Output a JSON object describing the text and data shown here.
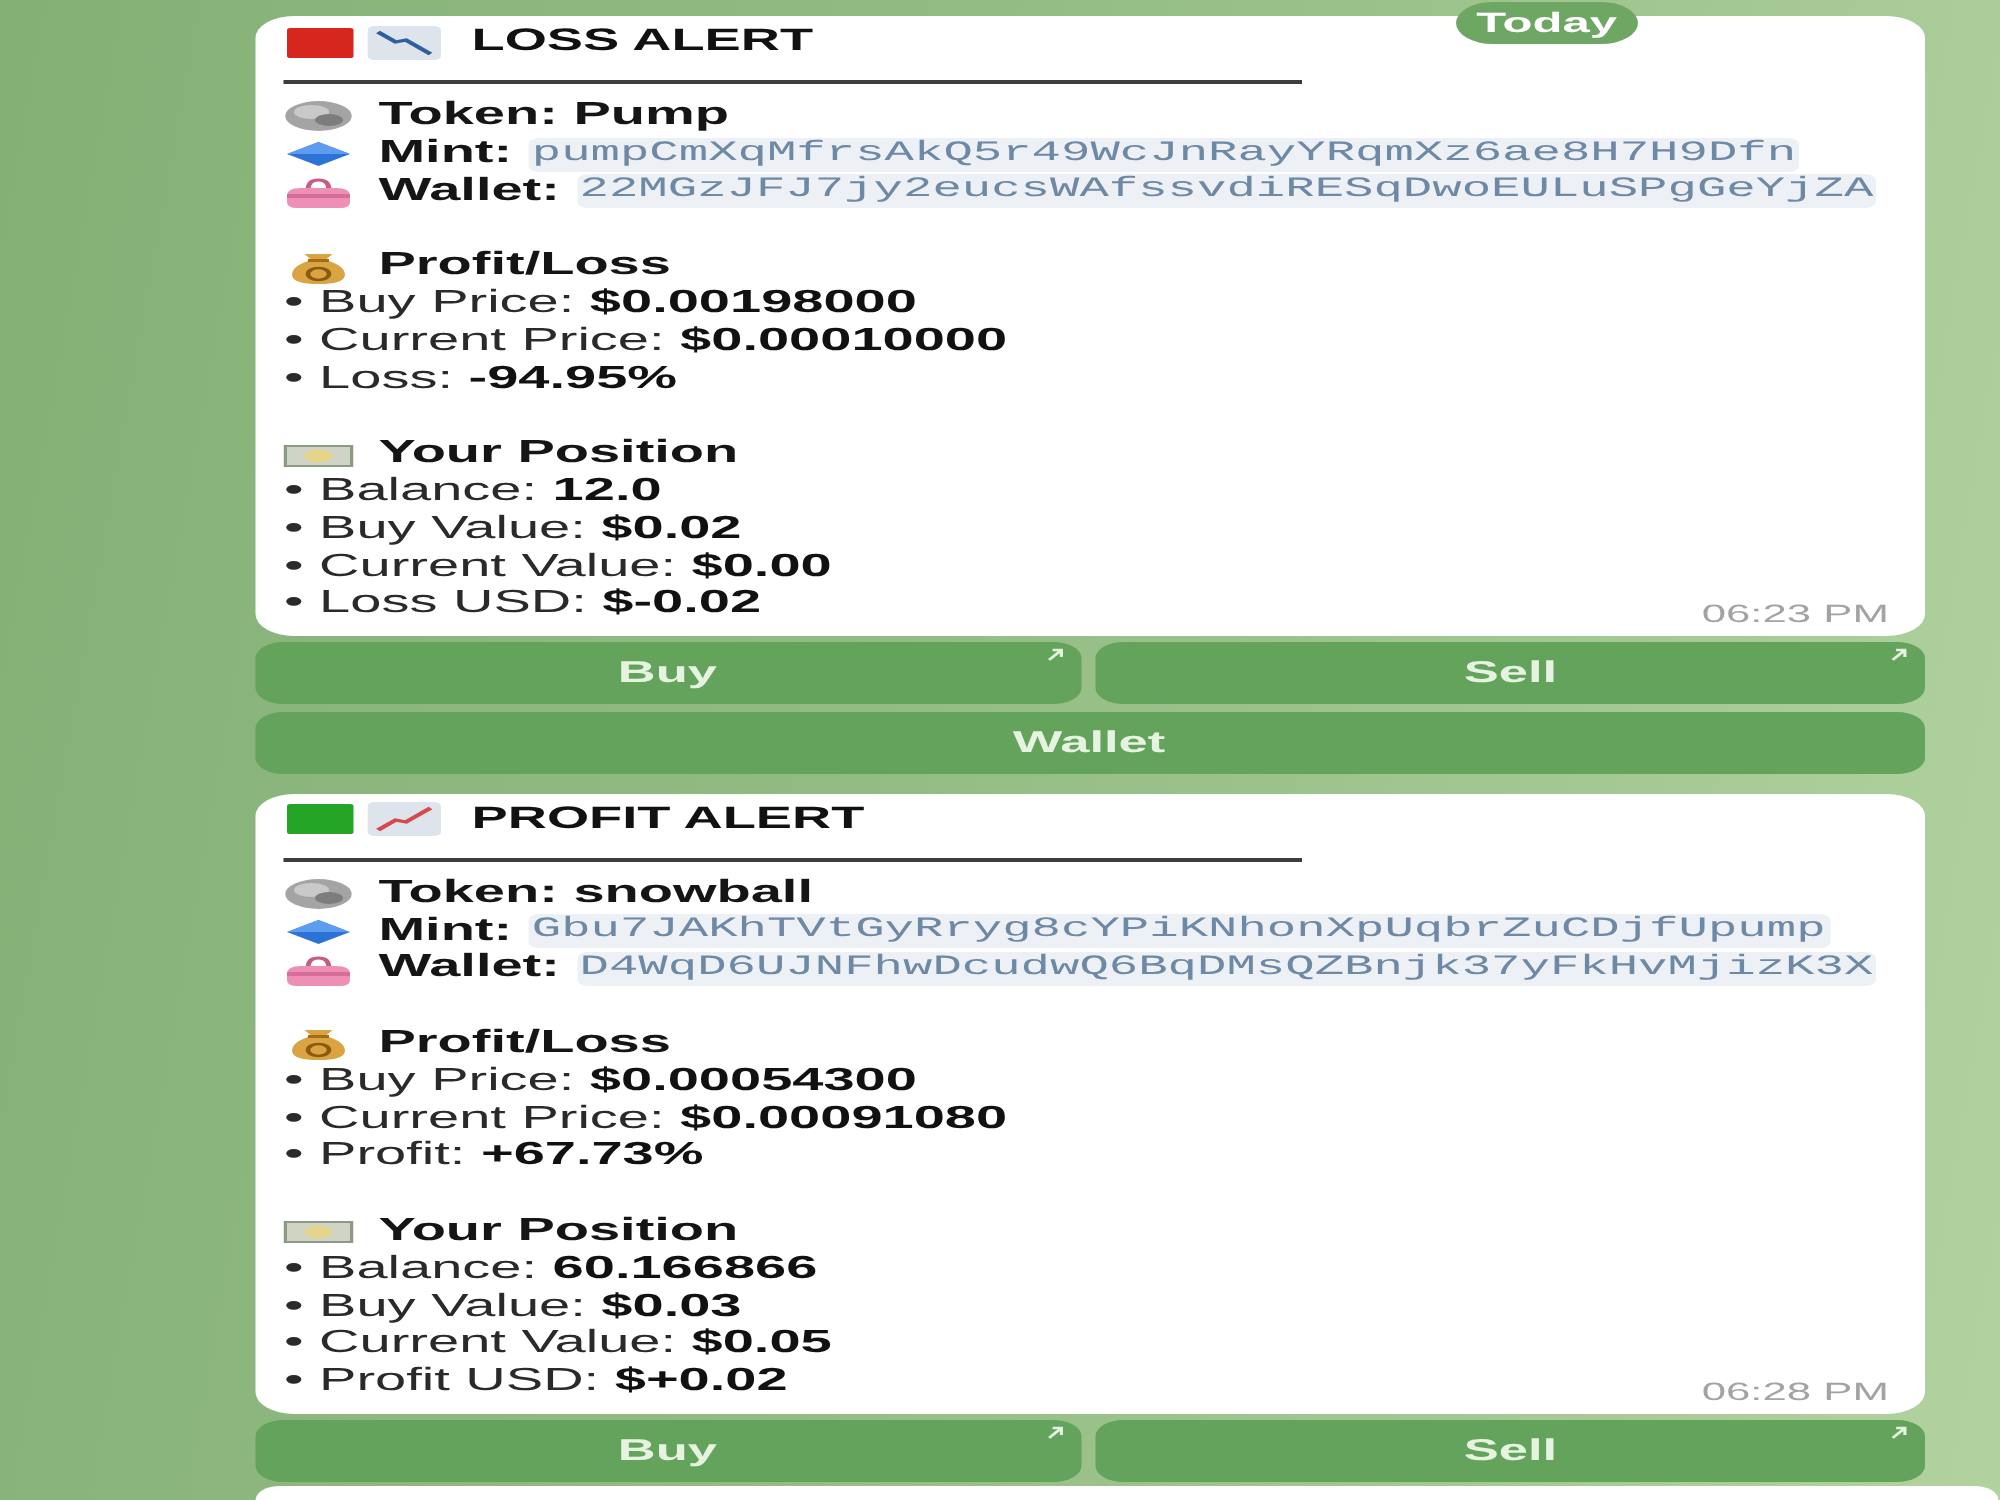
{
  "date_badge": {
    "label": "Today"
  },
  "messages": [
    {
      "kind": "loss",
      "color": "#d7261e",
      "title": "LOSS ALERT",
      "token_line": "Token: Pump",
      "fields": [
        {
          "kind": "mint",
          "label": "Mint:",
          "value": "pumpCmXqMfrsAkQ5r49WcJnRayYRqmXz6ae8H7H9Dfn"
        },
        {
          "kind": "wallet",
          "label": "Wallet:",
          "value": "22MGzJFJ7jy2eucsWAfssvdiRESqDwoEULuSPgGeYjZA"
        }
      ],
      "sections": [
        {
          "kind": "moneybag",
          "title": "Profit/Loss",
          "lines": [
            "• Buy Price: **$0.00198000**",
            "• Current Price: **$0.00010000**",
            "• Loss: **-94.95%**"
          ]
        },
        {
          "kind": "banknote",
          "title": "Your Position",
          "lines": [
            "• Balance: **12.0**",
            "• Buy Value: **$0.02**",
            "• Current Value: **$0.00**",
            "• Loss USD: **$-0.02**"
          ]
        }
      ],
      "time": "06:23 PM",
      "keyboard": [
        [
          {
            "label": "Buy",
            "external": true
          },
          {
            "label": "Sell",
            "external": true
          }
        ],
        [
          {
            "label": "Wallet",
            "external": false
          }
        ]
      ]
    },
    {
      "kind": "profit",
      "color": "#25a525",
      "title": "PROFIT ALERT",
      "token_line": "Token: snowball",
      "fields": [
        {
          "kind": "mint",
          "label": "Mint:",
          "value": "Gbu7JAKhTVtGyRryg8cYPiKNhonXpUqbrZuCDjfUpump"
        },
        {
          "kind": "wallet",
          "label": "Wallet:",
          "value": "D4WqD6UJNFhwDcudwQ6BqDMsQZBnjk37yFkHvMjizK3X"
        }
      ],
      "sections": [
        {
          "kind": "moneybag",
          "title": "Profit/Loss",
          "lines": [
            "• Buy Price: **$0.00054300**",
            "• Current Price: **$0.00091080**",
            "• Profit: **+67.73%**"
          ]
        },
        {
          "kind": "banknote",
          "title": "Your Position",
          "lines": [
            "• Balance: **60.166866**",
            "• Buy Value: **$0.03**",
            "• Current Value: **$0.05**",
            "• Profit USD: **$+0.02**"
          ]
        }
      ],
      "time": "06:28 PM",
      "keyboard": [
        [
          {
            "label": "Buy",
            "external": true
          },
          {
            "label": "Sell",
            "external": true
          }
        ]
      ]
    }
  ]
}
